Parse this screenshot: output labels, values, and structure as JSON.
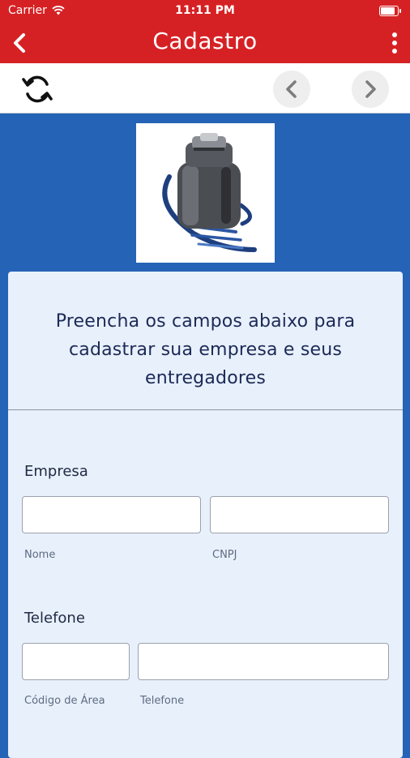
{
  "status_bar": {
    "carrier": "Carrier",
    "time": "11:11 PM",
    "battery_level": 0.95
  },
  "nav": {
    "title": "Cadastro",
    "back_icon": "chevron-left-icon",
    "menu_icon": "more-vertical-icon"
  },
  "toolbar": {
    "refresh_icon": "refresh-icon",
    "prev_icon": "chevron-left-icon",
    "next_icon": "chevron-right-icon"
  },
  "form": {
    "heading": "Preencha os campos abaixo para cadastrar sua empresa e seus entregadores",
    "empresa": {
      "label": "Empresa",
      "nome": {
        "value": "",
        "hint": "Nome"
      },
      "cnpj": {
        "value": "",
        "hint": "CNPJ"
      }
    },
    "telefone": {
      "label": "Telefone",
      "codigo_area": {
        "value": "",
        "hint": "Código de Área"
      },
      "numero": {
        "value": "",
        "hint": "Telefone"
      }
    }
  },
  "colors": {
    "accent": "#d62124",
    "background": "#2563b6",
    "card": "#e8f0fb",
    "heading": "#1c2a57"
  }
}
